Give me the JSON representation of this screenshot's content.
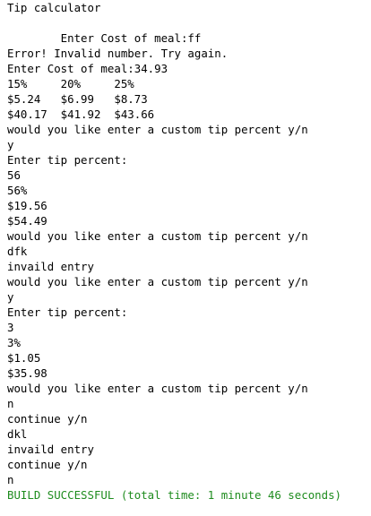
{
  "console": {
    "lines": [
      {
        "text": "Tip calculator",
        "kind": "normal"
      },
      {
        "text": "",
        "kind": "normal"
      },
      {
        "text": "        Enter Cost of meal:ff",
        "kind": "normal"
      },
      {
        "text": "Error! Invalid number. Try again.",
        "kind": "normal"
      },
      {
        "text": "Enter Cost of meal:34.93",
        "kind": "normal"
      },
      {
        "text": "15%     20%     25%",
        "kind": "normal"
      },
      {
        "text": "$5.24   $6.99   $8.73",
        "kind": "normal"
      },
      {
        "text": "$40.17  $41.92  $43.66",
        "kind": "normal"
      },
      {
        "text": "would you like enter a custom tip percent y/n",
        "kind": "normal"
      },
      {
        "text": "y",
        "kind": "normal"
      },
      {
        "text": "Enter tip percent:",
        "kind": "normal"
      },
      {
        "text": "56",
        "kind": "normal"
      },
      {
        "text": "56%",
        "kind": "normal"
      },
      {
        "text": "$19.56",
        "kind": "normal"
      },
      {
        "text": "$54.49",
        "kind": "normal"
      },
      {
        "text": "would you like enter a custom tip percent y/n",
        "kind": "normal"
      },
      {
        "text": "dfk",
        "kind": "normal"
      },
      {
        "text": "invaild entry",
        "kind": "normal"
      },
      {
        "text": "would you like enter a custom tip percent y/n",
        "kind": "normal"
      },
      {
        "text": "y",
        "kind": "normal"
      },
      {
        "text": "Enter tip percent:",
        "kind": "normal"
      },
      {
        "text": "3",
        "kind": "normal"
      },
      {
        "text": "3%",
        "kind": "normal"
      },
      {
        "text": "$1.05",
        "kind": "normal"
      },
      {
        "text": "$35.98",
        "kind": "normal"
      },
      {
        "text": "would you like enter a custom tip percent y/n",
        "kind": "normal"
      },
      {
        "text": "n",
        "kind": "normal"
      },
      {
        "text": "continue y/n",
        "kind": "normal"
      },
      {
        "text": "dkl",
        "kind": "normal"
      },
      {
        "text": "invaild entry",
        "kind": "normal"
      },
      {
        "text": "continue y/n",
        "kind": "normal"
      },
      {
        "text": "n",
        "kind": "normal"
      },
      {
        "text": "BUILD SUCCESSFUL (total time: 1 minute 46 seconds)",
        "kind": "success"
      }
    ]
  },
  "colors": {
    "background": "#ffffff",
    "text": "#000000",
    "success": "#1e8c1e"
  }
}
